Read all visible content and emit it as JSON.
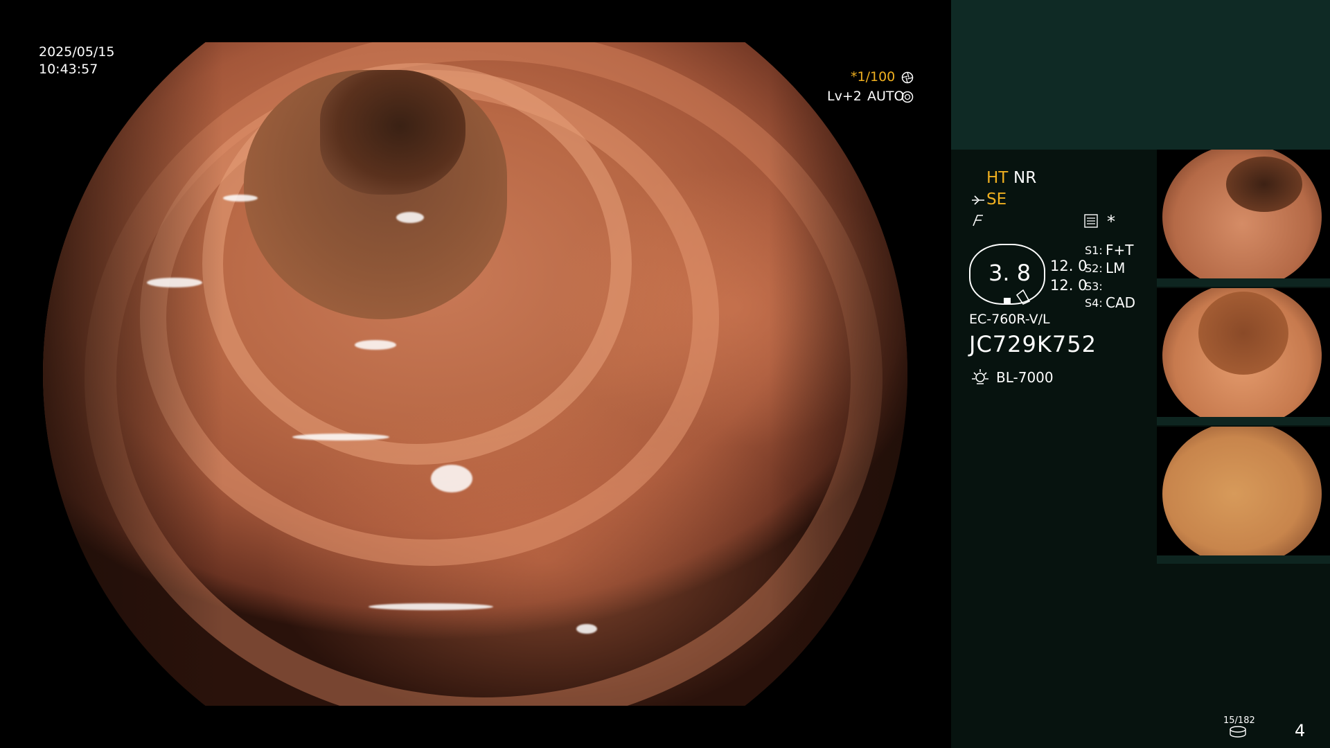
{
  "overlay": {
    "date": "2025/05/15",
    "time": "10:43:57",
    "shutter": "*1/100",
    "level": "Lv+2",
    "mode": "AUTO"
  },
  "panel": {
    "ht": "HT",
    "nr": "NR",
    "se": "SE",
    "asterisk": "*",
    "gauge_value": "3. 8",
    "val_a": "12. 0",
    "val_b": "12. 0",
    "s1_key": "S1:",
    "s1_val": "F+T",
    "s2_key": "S2:",
    "s2_val": "LM",
    "s3_key": "S3:",
    "s3_val": "",
    "s4_key": "S4:",
    "s4_val": "CAD",
    "scope_model": "EC-760R-V/L",
    "serial": "JC729K752",
    "light_source": "BL-7000",
    "storage_count": "15/182",
    "page_number": "4"
  },
  "colors": {
    "accent_yellow": "#f0b020",
    "panel_top": "#0f2a25",
    "panel_bg": "#07130f"
  },
  "icons": {
    "shutter": "aperture-icon",
    "mode": "aperture-icon",
    "filter": "filter-icon",
    "storage": "storage-icon",
    "light": "lamp-icon"
  }
}
